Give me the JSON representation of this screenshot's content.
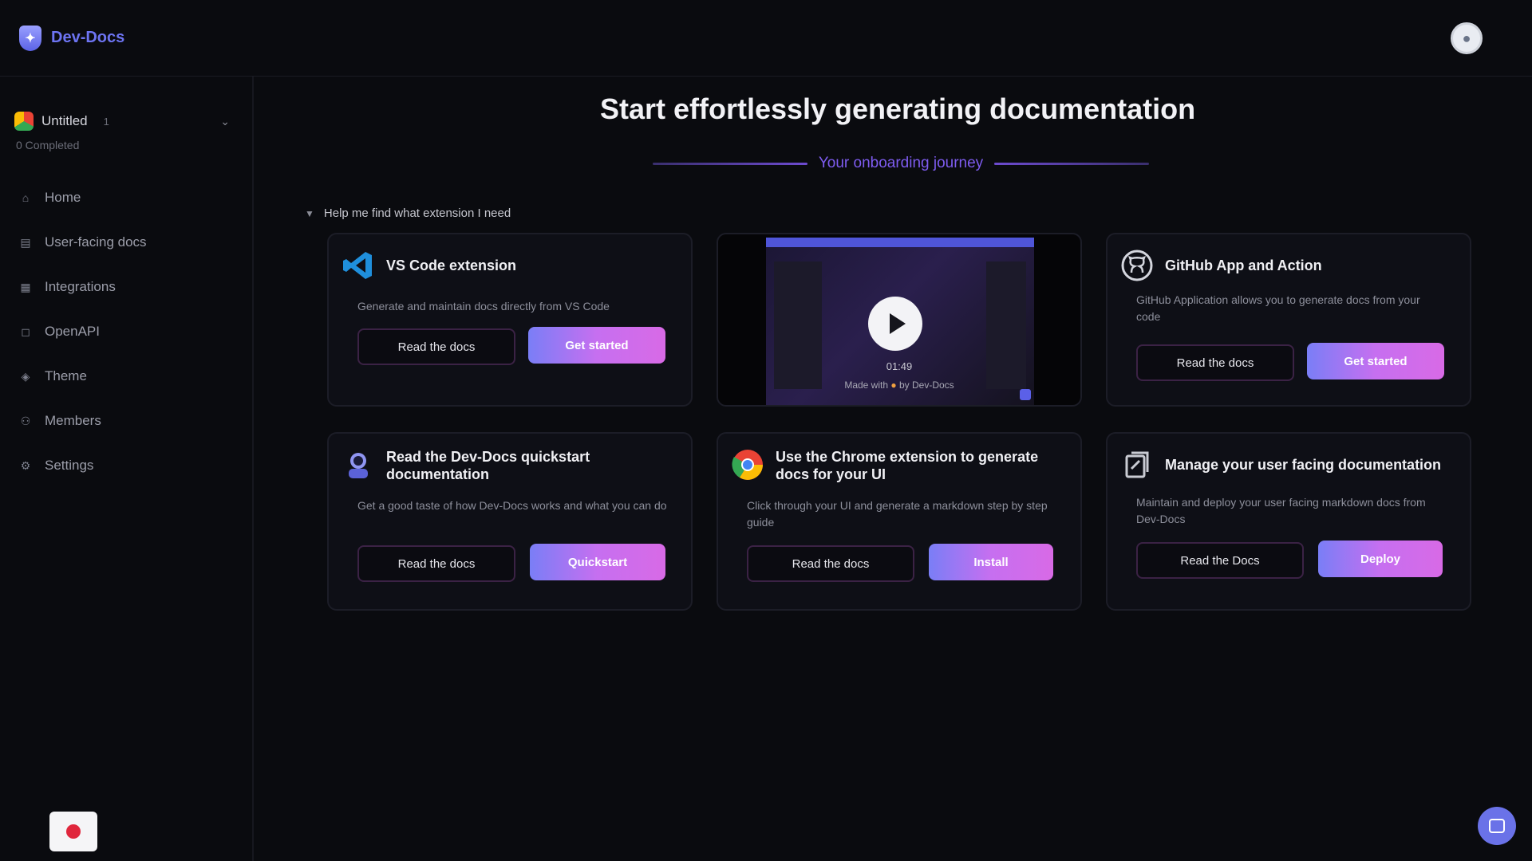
{
  "app": {
    "brand_name": "Dev-Docs",
    "brand_logo_icon": "shield-logo-icon"
  },
  "workspace": {
    "name": "Untitled",
    "switch_label": "1",
    "subtitle": "0 Completed"
  },
  "sidebar": {
    "items": [
      {
        "label": "Home",
        "icon": "home-icon"
      },
      {
        "label": "User-facing docs",
        "icon": "document-icon"
      },
      {
        "label": "Integrations",
        "icon": "integrations-icon"
      },
      {
        "label": "OpenAPI",
        "icon": "api-icon"
      },
      {
        "label": "Theme",
        "icon": "palette-icon"
      },
      {
        "label": "Members",
        "icon": "members-icon"
      },
      {
        "label": "Settings",
        "icon": "gear-icon"
      }
    ]
  },
  "main": {
    "title": "Start effortlessly generating documentation",
    "journey_label": "Your onboarding journey",
    "help_toggle": "Help me find what extension I need"
  },
  "cards": {
    "vscode": {
      "title": "VS Code extension",
      "description": "Generate and maintain docs directly from VS Code",
      "secondary": "Read the docs",
      "primary": "Get started"
    },
    "video": {
      "duration": "01:49",
      "caption_prefix": "Made with",
      "caption_suffix": "by Dev-Docs"
    },
    "github": {
      "title": "GitHub App and Action",
      "description": "GitHub Application allows you to generate docs from your code",
      "secondary": "Read the docs",
      "primary": "Get started"
    },
    "quickstart": {
      "title": "Read the Dev-Docs quickstart documentation",
      "description": "Get a good taste of how Dev-Docs works and what you can do",
      "secondary": "Read the docs",
      "primary": "Quickstart"
    },
    "chrome": {
      "title": "Use the Chrome extension to generate docs for your UI",
      "description": "Click through your UI and generate a markdown step by step guide",
      "secondary": "Read the docs",
      "primary": "Install"
    },
    "manage": {
      "title": "Manage your user facing documentation",
      "description": "Maintain and deploy your user facing markdown docs from Dev-Docs",
      "secondary": "Read the Docs",
      "primary": "Deploy"
    }
  },
  "colors": {
    "background": "#0a0b0f",
    "accent": "#6d74f2",
    "journey": "#7e5cf0",
    "button_gradient_start": "#7a7ef6",
    "button_gradient_end": "#d86ae6"
  }
}
